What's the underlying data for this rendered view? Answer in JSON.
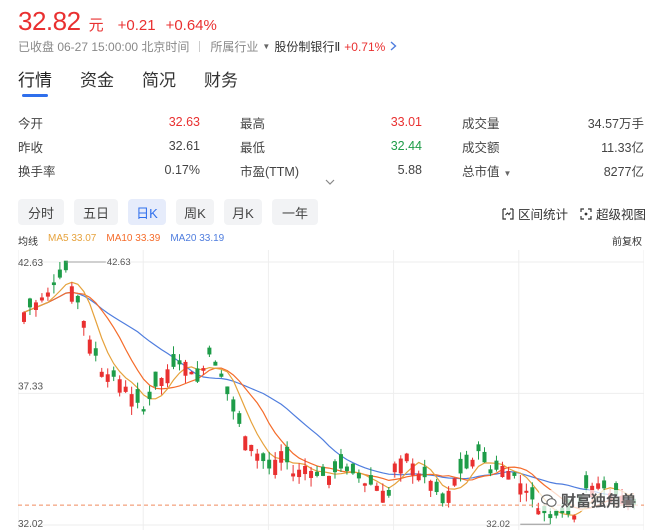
{
  "quote": {
    "price": "32.82",
    "unit": "元",
    "change": "+0.21",
    "change_pct": "+0.64%",
    "status": "已收盘 06-27 15:00:00 北京时间",
    "industry_label": "所属行业",
    "sector": "股份制银行Ⅱ",
    "sector_pct": "+0.71%"
  },
  "tabs": [
    {
      "label": "行情",
      "active": true
    },
    {
      "label": "资金"
    },
    {
      "label": "简况"
    },
    {
      "label": "财务"
    }
  ],
  "stats": [
    [
      {
        "label": "今开",
        "value": "32.63",
        "color": "red"
      },
      {
        "label": "最高",
        "value": "33.01",
        "color": "red"
      },
      {
        "label": "成交量",
        "value": "34.57万手"
      }
    ],
    [
      {
        "label": "昨收",
        "value": "32.61"
      },
      {
        "label": "最低",
        "value": "32.44",
        "color": "green"
      },
      {
        "label": "成交额",
        "value": "11.33亿"
      }
    ],
    [
      {
        "label": "换手率",
        "value": "0.17%"
      },
      {
        "label": "市盈(TTM)",
        "value": "5.88"
      },
      {
        "label": "总市值",
        "value": "8277亿",
        "dropdown": true
      }
    ]
  ],
  "periods": [
    {
      "label": "分时"
    },
    {
      "label": "五日"
    },
    {
      "label": "日K",
      "active": true
    },
    {
      "label": "周K"
    },
    {
      "label": "月K"
    },
    {
      "label": "一年"
    }
  ],
  "tools": {
    "range_stats": "区间统计",
    "super_view": "超级视图"
  },
  "legend": {
    "title": "均线",
    "ma5": "MA5 33.07",
    "ma10": "MA10 33.39",
    "ma20": "MA20 33.19",
    "adjust": "前复权"
  },
  "colors": {
    "up": "#e93030",
    "down": "#1e9c48",
    "ma5": "#e6a23c",
    "ma10": "#f56c2b",
    "ma20": "#4f7dde",
    "accent": "#2f6fec"
  },
  "watermark": "财富独角兽",
  "chart_data": {
    "type": "candlestick",
    "y_ticks": [
      "42.63",
      "37.33",
      "32.02"
    ],
    "ylim": [
      32.02,
      42.63
    ],
    "annotations": {
      "max_label": "42.63",
      "min_label": "32.02"
    },
    "reference_line": 32.82,
    "grid": true,
    "legend": "top-left",
    "anchors": [
      [
        0,
        40.6
      ],
      [
        4,
        41.4
      ],
      [
        7,
        42.3
      ],
      [
        9,
        41.0
      ],
      [
        11,
        39.5
      ],
      [
        13,
        38.2
      ],
      [
        16,
        37.9
      ],
      [
        18,
        37.3
      ],
      [
        20,
        36.6
      ],
      [
        22,
        37.6
      ],
      [
        24,
        38.3
      ],
      [
        27,
        38.6
      ],
      [
        29,
        37.8
      ],
      [
        31,
        38.9
      ],
      [
        33,
        38.0
      ],
      [
        35,
        36.6
      ],
      [
        37,
        35.6
      ],
      [
        39,
        34.9
      ],
      [
        41,
        34.3
      ],
      [
        43,
        35.0
      ],
      [
        45,
        34.1
      ],
      [
        47,
        34.4
      ],
      [
        49,
        34.0
      ],
      [
        51,
        34.0
      ],
      [
        53,
        34.3
      ],
      [
        55,
        34.1
      ],
      [
        57,
        33.7
      ],
      [
        59,
        33.6
      ],
      [
        61,
        33.2
      ],
      [
        62,
        34.5
      ],
      [
        64,
        34.9
      ],
      [
        66,
        34.1
      ],
      [
        68,
        33.8
      ],
      [
        70,
        32.9
      ],
      [
        72,
        33.9
      ],
      [
        74,
        34.3
      ],
      [
        76,
        35.0
      ],
      [
        78,
        34.1
      ],
      [
        80,
        34.4
      ],
      [
        82,
        34.0
      ],
      [
        84,
        33.4
      ],
      [
        86,
        32.7
      ],
      [
        88,
        32.3
      ],
      [
        90,
        32.5
      ],
      [
        92,
        32.4
      ],
      [
        94,
        33.5
      ],
      [
        96,
        33.7
      ],
      [
        98,
        33.3
      ],
      [
        100,
        33.2
      ],
      [
        102,
        32.82
      ]
    ]
  }
}
